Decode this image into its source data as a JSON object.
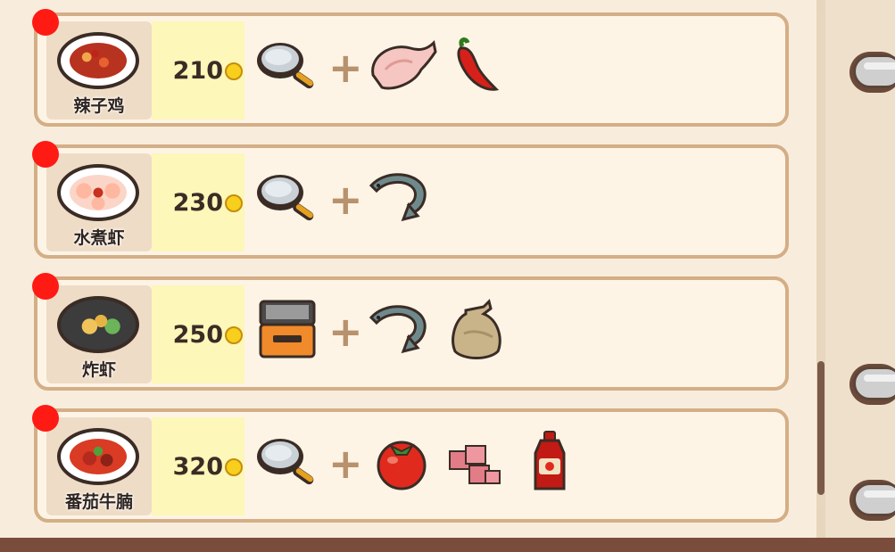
{
  "recipes": [
    {
      "name": "辣子鸡",
      "price": "210",
      "tool": "frying-pan-icon",
      "ingredients": [
        "chicken-icon",
        "chili-pepper-icon"
      ]
    },
    {
      "name": "水煮虾",
      "price": "230",
      "tool": "frying-pan-icon",
      "ingredients": [
        "shrimp-icon"
      ]
    },
    {
      "name": "炸虾",
      "price": "250",
      "tool": "deep-fryer-icon",
      "ingredients": [
        "shrimp-icon",
        "flour-sack-icon"
      ]
    },
    {
      "name": "番茄牛腩",
      "price": "320",
      "tool": "frying-pan-icon",
      "ingredients": [
        "tomato-icon",
        "beef-cubes-icon",
        "ketchup-bottle-icon"
      ]
    }
  ],
  "colors": {
    "new_indicator": "#ff1a14",
    "card_border": "#d4ae86",
    "price_tile": "#fdf7b9",
    "coin": "#f7cf1c"
  }
}
